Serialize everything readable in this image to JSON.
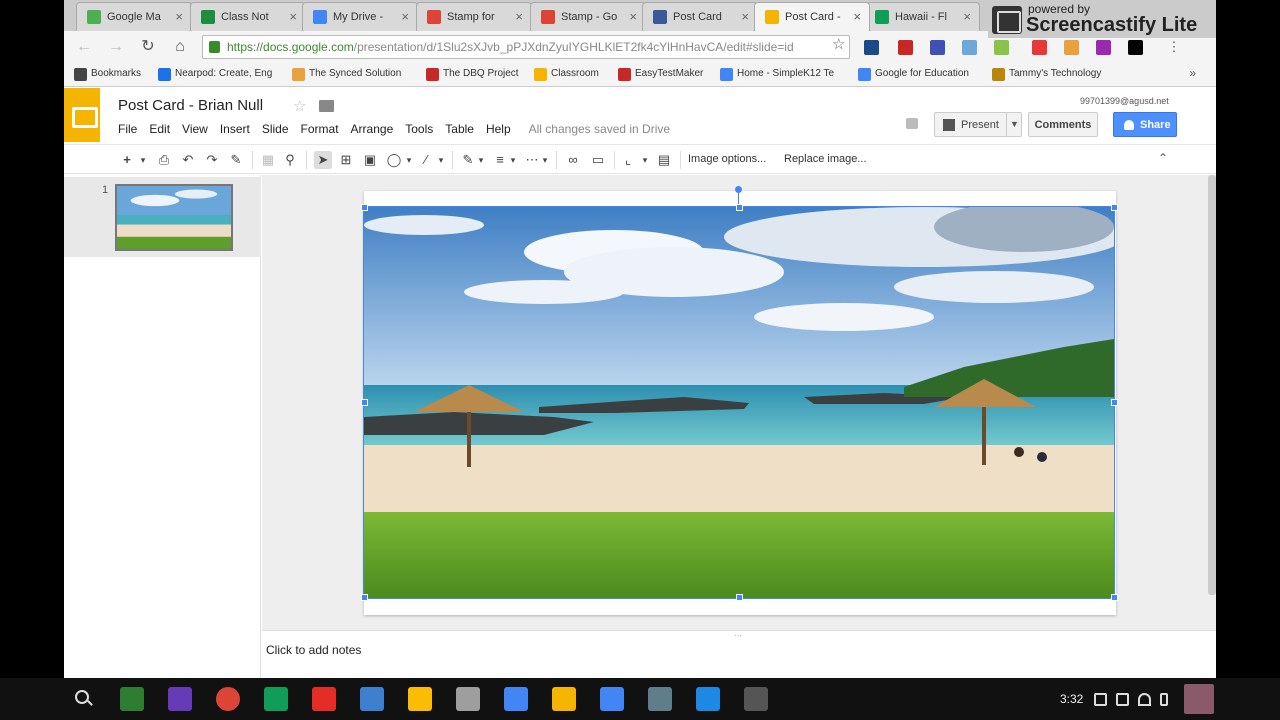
{
  "browser": {
    "tabs": [
      {
        "label": "Google Ma",
        "color": "#4caf50"
      },
      {
        "label": "Class Not",
        "color": "#1e8e3e"
      },
      {
        "label": "My Drive -",
        "color": "#4285f4"
      },
      {
        "label": "Stamp for",
        "color": "#db4437"
      },
      {
        "label": "Stamp - Go",
        "color": "#db4437"
      },
      {
        "label": "Post Card",
        "color": "#3b5998"
      },
      {
        "label": "Post Card -",
        "color": "#f4b400",
        "active": true
      },
      {
        "label": "Hawaii - Fl",
        "color": "#0f9d58"
      }
    ],
    "url_main": "https://docs.google.com",
    "url_rest": "/presentation/d/1Slu2sXJvb_pPJXdnZyuIYGHLKlET2fk4cYlHnHavCA/edit#slide=id",
    "bookmarks": [
      {
        "label": "Bookmarks",
        "color": "#444"
      },
      {
        "label": "Nearpod: Create, Eng",
        "color": "#1a73e8"
      },
      {
        "label": "The Synced Solution",
        "color": "#e8a33d"
      },
      {
        "label": "The DBQ Project",
        "color": "#c62828"
      },
      {
        "label": "Classroom",
        "color": "#f4b400"
      },
      {
        "label": "EasyTestMaker",
        "color": "#c62828"
      },
      {
        "label": "Home - SimpleK12 Te",
        "color": "#4285f4"
      },
      {
        "label": "Google for Education",
        "color": "#4285f4"
      },
      {
        "label": "Tammy's Technology",
        "color": "#b8860b"
      }
    ],
    "bookmarks_more": "»"
  },
  "screencastify": {
    "powered": "powered by",
    "name": "Screencastify Lite"
  },
  "slides": {
    "title": "Post Card - Brian Null",
    "menus": [
      "File",
      "Edit",
      "View",
      "Insert",
      "Slide",
      "Format",
      "Arrange",
      "Tools",
      "Table",
      "Help"
    ],
    "save_status": "All changes saved in Drive",
    "account": "99701399@agusd.net",
    "present": "Present",
    "comments": "Comments",
    "share": "Share",
    "image_options": "Image options...",
    "replace_image": "Replace image...",
    "slide_number": "1",
    "notes_placeholder": "Click to add notes"
  },
  "shelf": {
    "clock": "3:32",
    "apps": [
      {
        "name": "classroom-app",
        "color": "#2e7d32"
      },
      {
        "name": "forms-app",
        "color": "#673ab7"
      },
      {
        "name": "chrome-app",
        "color": "#db4437"
      },
      {
        "name": "sheets-app",
        "color": "#0f9d58"
      },
      {
        "name": "youtube-app",
        "color": "#e52d27"
      },
      {
        "name": "send-app",
        "color": "#3f7fd0"
      },
      {
        "name": "drive-app",
        "color": "#fbbc05"
      },
      {
        "name": "store-app",
        "color": "#9e9e9e"
      },
      {
        "name": "docs-app",
        "color": "#4285f4"
      },
      {
        "name": "slides-app",
        "color": "#f4b400"
      },
      {
        "name": "calendar-app",
        "color": "#4285f4"
      },
      {
        "name": "calculator-app",
        "color": "#607d8b"
      },
      {
        "name": "files-app",
        "color": "#1e88e5"
      },
      {
        "name": "video-app",
        "color": "#555555"
      }
    ]
  }
}
